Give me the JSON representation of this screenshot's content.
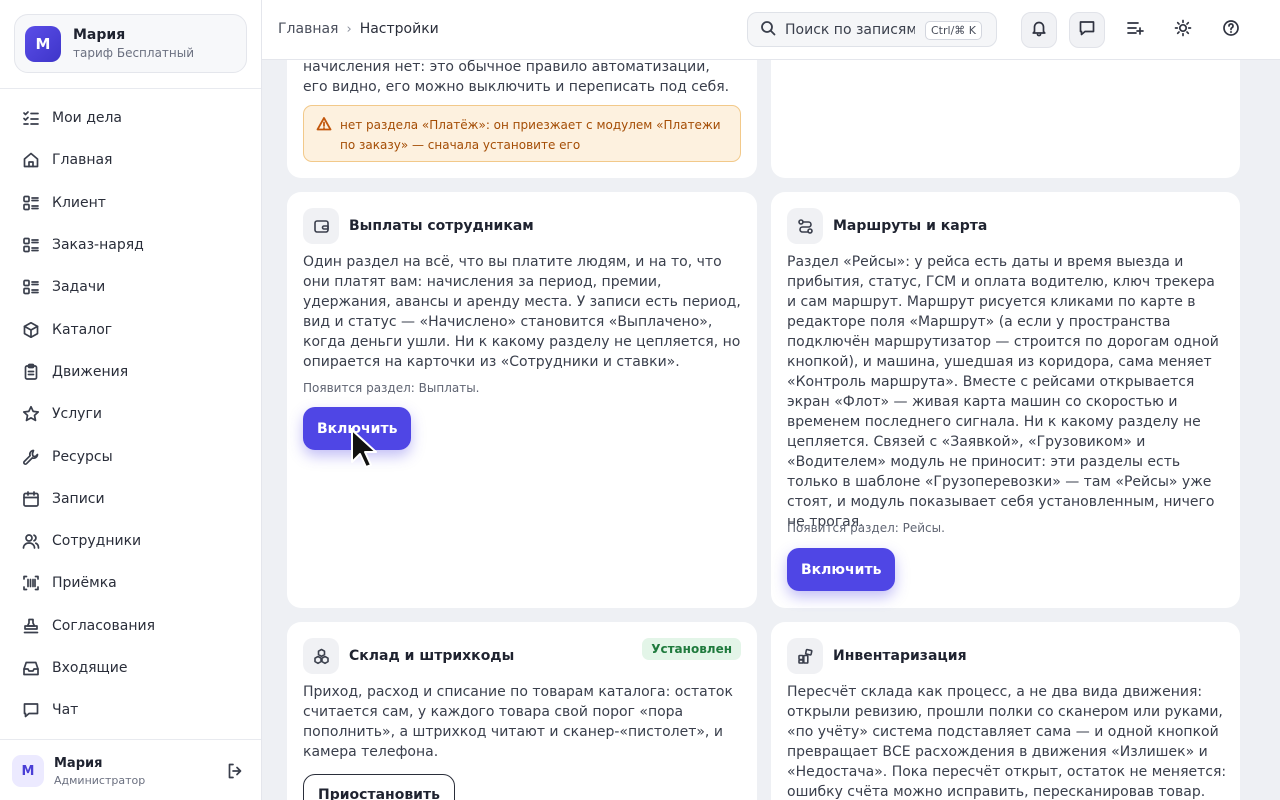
{
  "workspace": {
    "initial": "М",
    "name": "Мария",
    "plan": "тариф Бесплатный"
  },
  "nav": {
    "items": [
      {
        "label": "Мои дела",
        "icon": "checklist-icon"
      },
      {
        "label": "Главная",
        "icon": "home-icon"
      },
      {
        "label": "Клиент",
        "icon": "list-icon"
      },
      {
        "label": "Заказ-наряд",
        "icon": "list-icon"
      },
      {
        "label": "Задачи",
        "icon": "list-icon"
      },
      {
        "label": "Каталог",
        "icon": "box-icon"
      },
      {
        "label": "Движения",
        "icon": "clipboard-icon"
      },
      {
        "label": "Услуги",
        "icon": "star-icon"
      },
      {
        "label": "Ресурсы",
        "icon": "wrench-icon"
      },
      {
        "label": "Записи",
        "icon": "calendar-icon"
      },
      {
        "label": "Сотрудники",
        "icon": "users-icon"
      },
      {
        "label": "Приёмка",
        "icon": "barcode-scan-icon"
      },
      {
        "label": "Согласования",
        "icon": "stamp-icon"
      },
      {
        "label": "Входящие",
        "icon": "inbox-icon"
      },
      {
        "label": "Чат",
        "icon": "chat-icon"
      }
    ]
  },
  "user": {
    "initial": "М",
    "name": "Мария",
    "role": "Администратор"
  },
  "header": {
    "breadcrumb_home": "Главная",
    "breadcrumb_sep": "›",
    "breadcrumb_current": "Настройки",
    "search_placeholder": "Поиск по записям",
    "search_shortcut": "Ctrl/⌘ K"
  },
  "cards": {
    "top_left": {
      "desc": "начисления нет: это обычное правило автоматизации, его видно, его можно выключить и переписать под себя.",
      "warning": "нет раздела «Платёж»: он приезжает с модулем «Платежи по заказу» — сначала установите его"
    },
    "payouts": {
      "title": "Выплаты сотрудникам",
      "desc": "Один раздел на всё, что вы платите людям, и на то, что они платят вам: начисления за период, премии, удержания, авансы и аренду места. У записи есть период, вид и статус — «Начислено» становится «Выплачено», когда деньги ушли. Ни к какому разделу не цепляется, но опирается на карточки из «Сотрудники и ставки».",
      "note": "Появится раздел: Выплаты.",
      "button": "Включить"
    },
    "routes": {
      "title": "Маршруты и карта",
      "desc": "Раздел «Рейсы»: у рейса есть даты и время выезда и прибытия, статус, ГСМ и оплата водителю, ключ трекера и сам маршрут. Маршрут рисуется кликами по карте в редакторе поля «Маршрут» (а если у пространства подключён маршрутизатор — строится по дорогам одной кнопкой), и машина, ушедшая из коридора, сама меняет «Контроль маршрута». Вместе с рейсами открывается экран «Флот» — живая карта машин со скоростью и временем последнего сигнала. Ни к какому разделу не цепляется. Связей с «Заявкой», «Грузовиком» и «Водителем» модуль не приносит: эти разделы есть только в шаблоне «Грузоперевозки» — там «Рейсы» уже стоят, и модуль показывает себя установленным, ничего не трогая.",
      "note": "Появится раздел: Рейсы.",
      "button": "Включить"
    },
    "warehouse": {
      "title": "Склад и штрихкоды",
      "badge": "Установлен",
      "desc": "Приход, расход и списание по товарам каталога: остаток считается сам, у каждого товара свой порог «пора пополнить», а штрихкод читают и сканер-«пистолет», и камера телефона.",
      "button": "Приостановить"
    },
    "inventory": {
      "title": "Инвентаризация",
      "desc": "Пересчёт склада как процесс, а не два вида движения: открыли ревизию, прошли полки со сканером или руками, «по учёту» система подставляет сама — и одной кнопкой превращает ВСЕ расхождения в движения «Излишек» и «Недостача». Пока пересчёт открыт, остаток не меняется: ошибку счёта можно исправить, пересканировав товар."
    }
  },
  "colors": {
    "accent": "#4f46e5",
    "warning_bg": "#fdf1df",
    "warning_text": "#a44d05",
    "success_bg": "#e3f5e8",
    "success_text": "#1f7a3d"
  }
}
